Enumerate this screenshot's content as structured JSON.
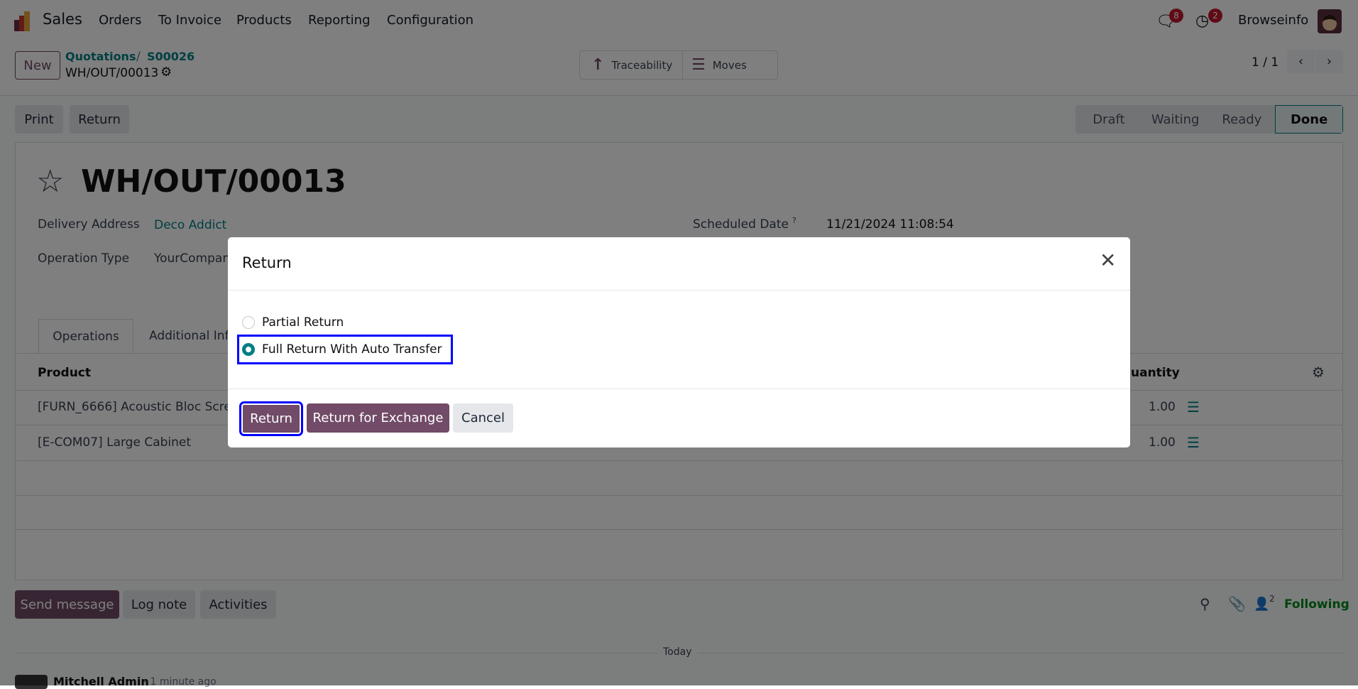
{
  "navbar": {
    "app": "Sales",
    "menus": [
      "Orders",
      "To Invoice",
      "Products",
      "Reporting",
      "Configuration"
    ],
    "messages_count": "8",
    "activities_count": "2",
    "user": "Browseinfo"
  },
  "control": {
    "new_label": "New",
    "breadcrumb": [
      "Quotations",
      "S00026"
    ],
    "current": "WH/OUT/00013",
    "traceability": "Traceability",
    "moves": "Moves",
    "pager": "1 / 1"
  },
  "actions": {
    "print": "Print",
    "return": "Return"
  },
  "statusbar": [
    "Draft",
    "Waiting",
    "Ready",
    "Done"
  ],
  "form": {
    "title": "WH/OUT/00013",
    "delivery_label": "Delivery Address",
    "delivery_value": "Deco Addict",
    "optype_label": "Operation Type",
    "optype_value": "YourCompan",
    "sched_label": "Scheduled Date",
    "sched_help": "?",
    "sched_value": "11/21/2024 11:08:54",
    "tabs": [
      "Operations",
      "Additional Inf"
    ],
    "col_product": "Product",
    "col_quantity": "uantity",
    "rows": [
      {
        "product": "[FURN_6666] Acoustic Bloc Scree",
        "qty": "1.00"
      },
      {
        "product": "[E-COM07] Large Cabinet",
        "qty": "1.00"
      }
    ]
  },
  "chatter": {
    "send": "Send message",
    "log": "Log note",
    "activities": "Activities",
    "followers": "2",
    "following": "Following",
    "today": "Today",
    "author": "Mitchell Admin",
    "time": "- 1 minute ago"
  },
  "modal": {
    "title": "Return",
    "options": [
      "Partial Return",
      "Full Return With Auto Transfer"
    ],
    "selected": 1,
    "buttons": {
      "return": "Return",
      "exchange": "Return for Exchange",
      "cancel": "Cancel"
    }
  }
}
